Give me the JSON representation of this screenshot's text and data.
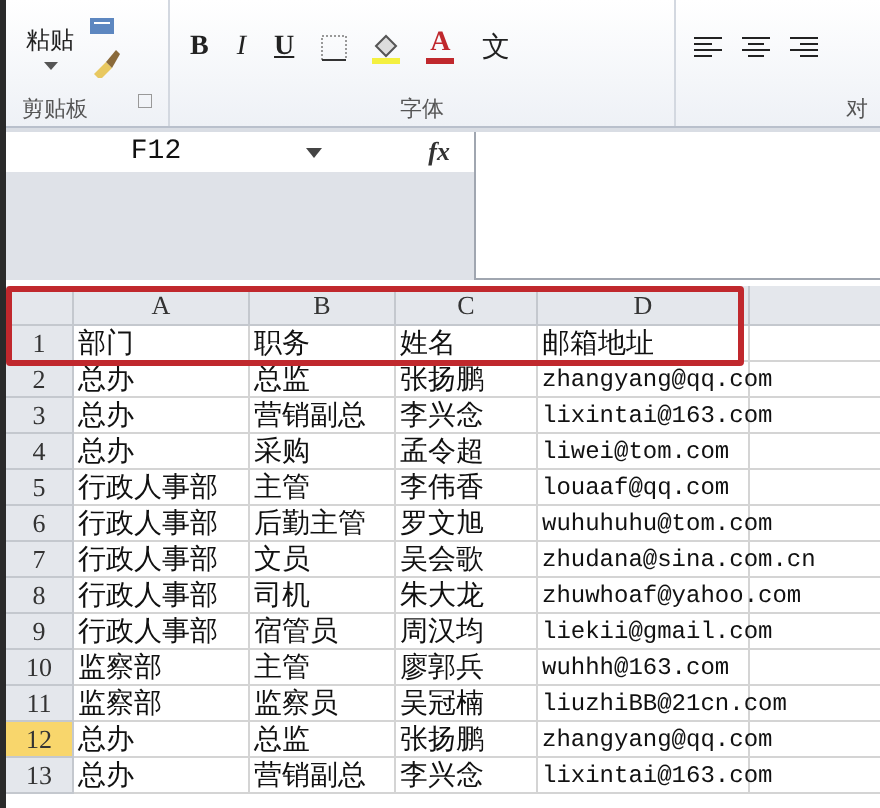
{
  "ribbon": {
    "groups": [
      {
        "kind": "clipboard",
        "label": "剪贴板",
        "paste_label": "粘贴"
      },
      {
        "kind": "font",
        "label": "字体",
        "bold": "B",
        "italic": "I",
        "underline": "U",
        "font_color": "A",
        "phonetic": "文"
      },
      {
        "kind": "alignment",
        "label": "对"
      }
    ]
  },
  "formula_bar": {
    "name_box": "F12",
    "fx": "fx"
  },
  "columns": [
    "A",
    "B",
    "C",
    "D"
  ],
  "rows": [
    {
      "number": "1",
      "selected": false,
      "cells": [
        "部门",
        "职务",
        "姓名",
        "邮箱地址"
      ]
    },
    {
      "number": "2",
      "selected": false,
      "cells": [
        "总办",
        "总监",
        "张扬鹏",
        "zhangyang@qq.com"
      ]
    },
    {
      "number": "3",
      "selected": false,
      "cells": [
        "总办",
        "营销副总",
        "李兴念",
        "lixintai@163.com"
      ]
    },
    {
      "number": "4",
      "selected": false,
      "cells": [
        "总办",
        "采购",
        "孟令超",
        "liwei@tom.com"
      ]
    },
    {
      "number": "5",
      "selected": false,
      "cells": [
        "行政人事部",
        "主管",
        "李伟香",
        "louaaf@qq.com"
      ]
    },
    {
      "number": "6",
      "selected": false,
      "cells": [
        "行政人事部",
        "后勤主管",
        "罗文旭",
        "wuhuhuhu@tom.com"
      ]
    },
    {
      "number": "7",
      "selected": false,
      "cells": [
        "行政人事部",
        "文员",
        "吴会歌",
        "zhudana@sina.com.cn"
      ]
    },
    {
      "number": "8",
      "selected": false,
      "cells": [
        "行政人事部",
        "司机",
        "朱大龙",
        "zhuwhoaf@yahoo.com"
      ]
    },
    {
      "number": "9",
      "selected": false,
      "cells": [
        "行政人事部",
        "宿管员",
        "周汉均",
        "liekii@gmail.com"
      ]
    },
    {
      "number": "10",
      "selected": false,
      "cells": [
        "监察部",
        "主管",
        "廖郭兵",
        "wuhhh@163.com"
      ]
    },
    {
      "number": "11",
      "selected": false,
      "cells": [
        "监察部",
        "监察员",
        "吴冠楠",
        "liuzhiBB@21cn.com"
      ]
    },
    {
      "number": "12",
      "selected": true,
      "cells": [
        "总办",
        "总监",
        "张扬鹏",
        "zhangyang@qq.com"
      ]
    },
    {
      "number": "13",
      "selected": false,
      "cells": [
        "总办",
        "营销副总",
        "李兴念",
        "lixintai@163.com"
      ]
    }
  ]
}
